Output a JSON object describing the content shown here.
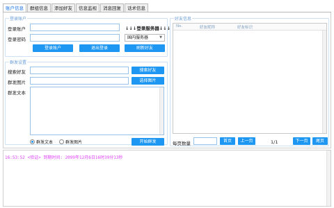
{
  "tabs": [
    {
      "label": "账户信息",
      "active": true
    },
    {
      "label": "群组信息",
      "active": false
    },
    {
      "label": "添加好友",
      "active": false
    },
    {
      "label": "信息监视",
      "active": false
    },
    {
      "label": "消息回复",
      "active": false
    },
    {
      "label": "话术信息",
      "active": false
    }
  ],
  "login": {
    "title": "登录账户",
    "account_label": "登录账户",
    "password_label": "登录密码",
    "account_value": "",
    "password_value": "",
    "server_label": "↓↓↓登录服务器↓↓↓",
    "server_selected": "国内服务器",
    "login_button": "登录账户",
    "logout_button": "退出登录",
    "refresh_button": "刷新好友"
  },
  "group_send": {
    "title": "群发设置",
    "search_label": "搜索好友",
    "image_label": "群发图片",
    "text_label": "群发文本",
    "search_button": "搜索好友",
    "choose_image_button": "选择图片",
    "radio_text": "群发文本",
    "radio_image": "群发图片",
    "radio_selected": "text",
    "start_button": "开始群发"
  },
  "friends": {
    "title": "好友信息",
    "columns": [
      "No.",
      "好友昵称",
      "好友标识"
    ],
    "per_page_label": "每页数量",
    "per_page_value": "",
    "first_page": "首页",
    "prev_page": "上一页",
    "page_indicator": "1/1",
    "next_page": "下一页",
    "last_page": "尾页"
  },
  "log": {
    "line": "16:53:52 <验证> 到期时间: 2099年12月6日16时39分13秒"
  },
  "colors": {
    "button": "#1e97f3",
    "log_text": "#e040fb",
    "group_title": "#6b9ed6",
    "active_tab": "#1a73e8"
  }
}
